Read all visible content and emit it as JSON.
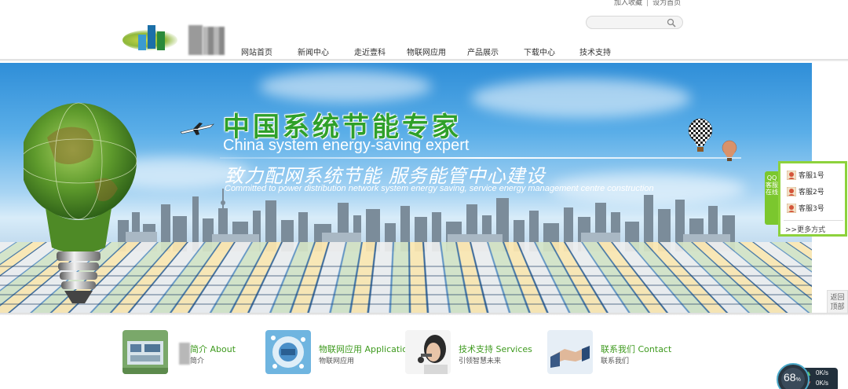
{
  "header": {
    "add_favorite": "加入收藏",
    "separator": "|",
    "set_homepage": "设为首页",
    "search_placeholder": ""
  },
  "nav": {
    "items": [
      {
        "label": "网站首页"
      },
      {
        "label": "新闻中心"
      },
      {
        "label": "走近壹科"
      },
      {
        "label": "物联网应用"
      },
      {
        "label": "产品展示"
      },
      {
        "label": "下载中心"
      },
      {
        "label": "技术支持"
      }
    ]
  },
  "banner": {
    "cn_title": "中国系统节能专家",
    "en_title": "China system energy-saving expert",
    "cn_subtitle": "致力配网系统节能 服务能管中心建设",
    "en_subtitle": "Committed to power distribution network system energy saving, service energy management centre construction"
  },
  "qq": {
    "tab_label": "QQ客服在线",
    "agents": [
      "客服1号",
      "客服2号",
      "客服3号"
    ],
    "more": ">>更多方式"
  },
  "backtop": {
    "label_line1": "返回",
    "label_line2": "顶部"
  },
  "features": [
    {
      "title": "简介 About",
      "sub": "简介"
    },
    {
      "title": "物联网应用 Application",
      "sub": "物联网应用"
    },
    {
      "title": "技术支持 Services",
      "sub": "引领智慧未来"
    },
    {
      "title": "联系我们 Contact",
      "sub": "联系我们"
    }
  ],
  "speed_widget": {
    "percent": "68",
    "percent_unit": "%",
    "up_rate": "0K/s",
    "down_rate": "0K/s"
  },
  "colors": {
    "accent_green": "#3e9a1e",
    "qq_green": "#8dd23c",
    "title_green": "#2fa02a"
  }
}
